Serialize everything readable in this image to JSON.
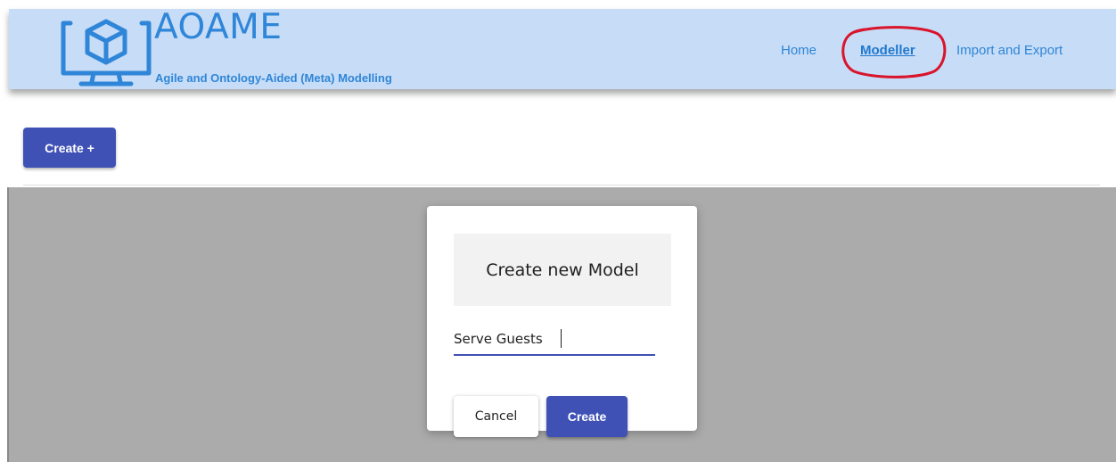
{
  "app": {
    "title": "AOAME",
    "subtitle": "Agile and Ontology-Aided (Meta) Modelling",
    "logo_icon": "monitor-cube-icon"
  },
  "nav": {
    "items": [
      {
        "label": "Home"
      },
      {
        "label": "Modeller",
        "active": true
      },
      {
        "label": "Import and Export"
      }
    ]
  },
  "toolbar": {
    "create_label": "Create +"
  },
  "dialog": {
    "title": "Create new Model",
    "input_value": "Serve Guests",
    "cancel_label": "Cancel",
    "create_label": "Create"
  },
  "colors": {
    "header_bg": "#c7dcf6",
    "brand_blue": "#2f86d8",
    "primary_button": "#3f51b5",
    "overlay": "#ababab",
    "annotation_circle": "#d9142b"
  }
}
